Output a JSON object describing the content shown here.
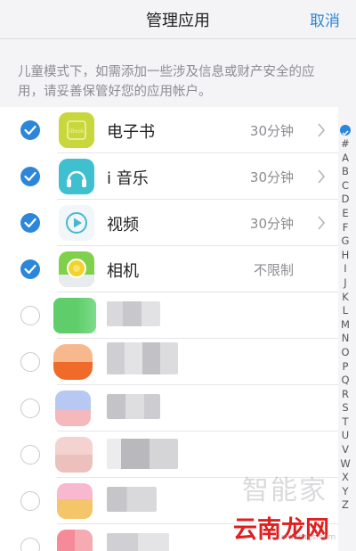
{
  "header": {
    "title": "管理应用",
    "cancel_label": "取消"
  },
  "notice": "儿童模式下，如需添加一些涉及信息或财产安全的应用，请妥善保管好您的应用帐户。",
  "apps": [
    {
      "name": "电子书",
      "limit": "30分钟",
      "checked": true,
      "icon": "ebook-icon"
    },
    {
      "name": "i 音乐",
      "limit": "30分钟",
      "checked": true,
      "icon": "music-icon"
    },
    {
      "name": "视频",
      "limit": "30分钟",
      "checked": true,
      "icon": "video-icon"
    },
    {
      "name": "相机",
      "limit": "不限制",
      "checked": true,
      "icon": "camera-icon"
    }
  ],
  "index_bar": [
    "#",
    "A",
    "B",
    "C",
    "D",
    "E",
    "F",
    "G",
    "H",
    "I",
    "J",
    "K",
    "L",
    "M",
    "N",
    "O",
    "P",
    "Q",
    "R",
    "S",
    "T",
    "U",
    "V",
    "W",
    "X",
    "Y",
    "Z"
  ],
  "watermark": {
    "line1": "智能家",
    "line2": "云南龙网",
    "line3": "smartnjs.com"
  },
  "colors": {
    "accent": "#2c86d9",
    "background": "#f4f4f6"
  }
}
